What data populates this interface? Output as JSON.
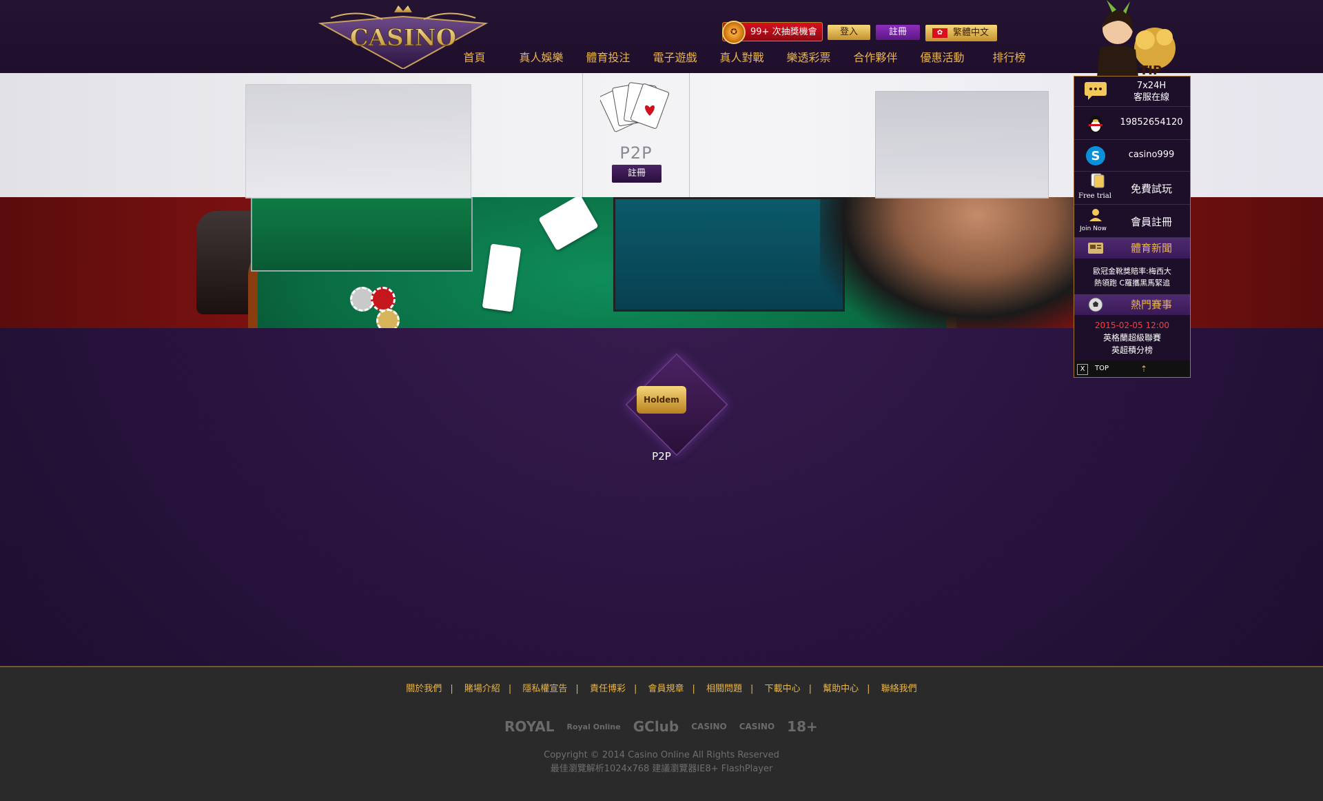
{
  "header": {
    "logo_text": "CASINO",
    "promo_label": "99+ 次抽獎機會",
    "login_label": "登入",
    "register_label": "註冊",
    "language_label": "繁體中文",
    "nav": [
      "首頁",
      "真人娛樂",
      "體育投注",
      "電子遊戲",
      "真人對戰",
      "樂透彩票",
      "合作夥伴",
      "優惠活動",
      "排行榜"
    ]
  },
  "banner": {
    "panel_title": "P2P",
    "panel_register": "註冊"
  },
  "game": {
    "badge": "Holdem",
    "label": "P2P"
  },
  "side_panel": {
    "tip_label": "TIP",
    "service_line1": "7x24H",
    "service_line2": "客服在線",
    "qq": "19852654120",
    "skype": "casino999",
    "free_trial_icon_caption": "Free trial",
    "free_trial": "免費試玩",
    "join_icon_caption": "Join Now",
    "join": "會員註冊",
    "sports_news_header": "體育新聞",
    "sports_news_line1": "歐冠金靴獎賠率:梅西大",
    "sports_news_line2": "熱領跑 C羅攜黑馬緊追",
    "hot_events_header": "熱門賽事",
    "event_date": "2015-02-05 12:00",
    "event_line1": "英格蘭超級聯賽",
    "event_line2": "英超積分榜",
    "close_label": "X",
    "top_label": "TOP"
  },
  "footer": {
    "links": [
      "關於我們",
      "賭場介紹",
      "隱私權宣告",
      "責任博彩",
      "會員規章",
      "相關問題",
      "下載中心",
      "幫助中心",
      "聯絡我們"
    ],
    "logos": [
      "ROYAL",
      "Royal Online",
      "GClub",
      "CASINO",
      "CASINO",
      "18+"
    ],
    "copyright": "Copyright © 2014 Casino Online All Rights Reserved",
    "browser_note": "最佳瀏覽解析1024x768 建議瀏覽器IE8+ FlashPlayer"
  },
  "colors": {
    "gold": "#e8b54a",
    "purple_bg": "#2a1440",
    "promo_red": "#d8101d",
    "register_purple": "#6a1f9a",
    "footer_bg": "#2a2a2a"
  }
}
